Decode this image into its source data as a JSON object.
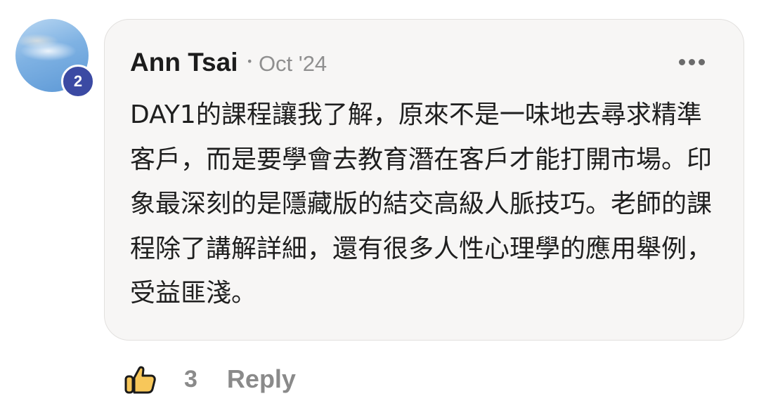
{
  "comment": {
    "author": "Ann Tsai",
    "separator": "•",
    "date": "Oct '24",
    "avatar_badge": "2",
    "text": "DAY1的課程讓我了解，原來不是一味地去尋求精準客戶，而是要學會去教育潛在客戶才能打開市場。印象最深刻的是隱藏版的結交高級人脈技巧。老師的課程除了講解詳細，還有很多人性心理學的應用舉例，受益匪淺。",
    "more_icon": "more-horizontal-icon"
  },
  "actions": {
    "like_icon": "thumbs-up-icon",
    "like_count": "3",
    "reply_label": "Reply"
  },
  "colors": {
    "bubble_background": "#f7f6f5",
    "badge": "#3b4aa3",
    "like_icon_fill": "#f7c75a",
    "muted_text": "#8a8a8a"
  }
}
